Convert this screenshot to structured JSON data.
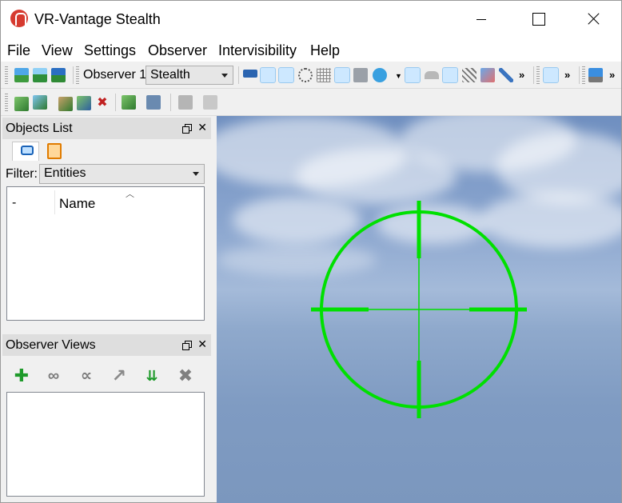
{
  "window": {
    "title": "VR-Vantage Stealth"
  },
  "menu": {
    "file": "File",
    "view": "View",
    "settings": "Settings",
    "observer": "Observer",
    "intervisibility": "Intervisibility",
    "help": "Help"
  },
  "toolbar": {
    "observer_label": "Observer 1",
    "observer_mode": "Stealth",
    "more": "»"
  },
  "objects_list": {
    "title": "Objects List",
    "filter_label": "Filter:",
    "filter_value": "Entities",
    "col_dash": "-",
    "col_name": "Name"
  },
  "observer_views": {
    "title": "Observer Views"
  },
  "view": {
    "reticle_color": "#00e000"
  }
}
